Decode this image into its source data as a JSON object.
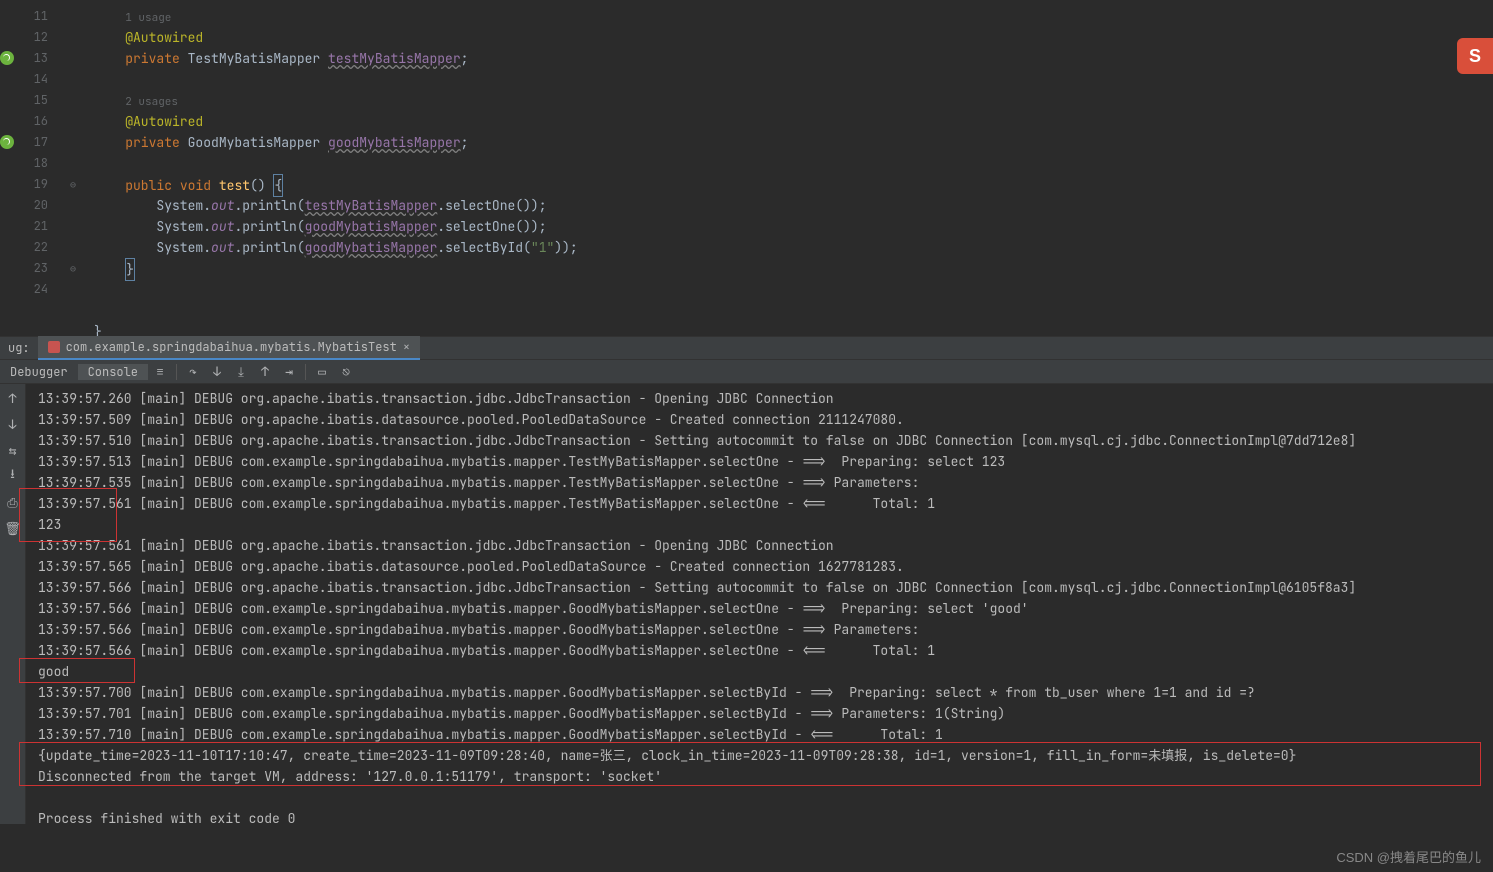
{
  "gutter": {
    "start": 11,
    "end": 24,
    "highlights": [
      12,
      15
    ]
  },
  "editor": {
    "usage1": "1 usage",
    "anno": "@Autowired",
    "kw_private": "private",
    "type1": "TestMyBatisMapper",
    "field1": "testMyBatisMapper",
    "semi": ";",
    "usage2": "2 usages",
    "type2": "GoodMybatisMapper",
    "field2": "goodMybatisMapper",
    "kw_public": "public",
    "kw_void": "void",
    "method_test": "test",
    "paren_empty": "() ",
    "brace_open": "{",
    "brace_close": "}",
    "sys": "System",
    "out": "out",
    "println": "println",
    "call1": "testMyBatisMapper",
    "selectOne": "selectOne",
    "call2": "goodMybatisMapper",
    "selectById": "selectById",
    "arg_str": "\"1\""
  },
  "debugbar": {
    "label": "ug:",
    "tab": "com.example.springdabaihua.mybatis.MybatisTest",
    "close": "×"
  },
  "toolbar2": {
    "debugger": "Debugger",
    "console": "Console"
  },
  "console_lines": [
    "13:39:57.260 [main] DEBUG org.apache.ibatis.transaction.jdbc.JdbcTransaction - Opening JDBC Connection",
    "13:39:57.509 [main] DEBUG org.apache.ibatis.datasource.pooled.PooledDataSource - Created connection 2111247080.",
    "13:39:57.510 [main] DEBUG org.apache.ibatis.transaction.jdbc.JdbcTransaction - Setting autocommit to false on JDBC Connection [com.mysql.cj.jdbc.ConnectionImpl@7dd712e8]",
    "13:39:57.513 [main] DEBUG com.example.springdabaihua.mybatis.mapper.TestMyBatisMapper.selectOne - ==>  Preparing: select 123",
    "13:39:57.535 [main] DEBUG com.example.springdabaihua.mybatis.mapper.TestMyBatisMapper.selectOne - ==> Parameters: ",
    "13:39:57.561 [main] DEBUG com.example.springdabaihua.mybatis.mapper.TestMyBatisMapper.selectOne - <==      Total: 1",
    "123",
    "13:39:57.561 [main] DEBUG org.apache.ibatis.transaction.jdbc.JdbcTransaction - Opening JDBC Connection",
    "13:39:57.565 [main] DEBUG org.apache.ibatis.datasource.pooled.PooledDataSource - Created connection 1627781283.",
    "13:39:57.566 [main] DEBUG org.apache.ibatis.transaction.jdbc.JdbcTransaction - Setting autocommit to false on JDBC Connection [com.mysql.cj.jdbc.ConnectionImpl@6105f8a3]",
    "13:39:57.566 [main] DEBUG com.example.springdabaihua.mybatis.mapper.GoodMybatisMapper.selectOne - ==>  Preparing: select 'good'",
    "13:39:57.566 [main] DEBUG com.example.springdabaihua.mybatis.mapper.GoodMybatisMapper.selectOne - ==> Parameters: ",
    "13:39:57.566 [main] DEBUG com.example.springdabaihua.mybatis.mapper.GoodMybatisMapper.selectOne - <==      Total: 1",
    "good",
    "13:39:57.700 [main] DEBUG com.example.springdabaihua.mybatis.mapper.GoodMybatisMapper.selectById - ==>  Preparing: select * from tb_user where 1=1 and id =?",
    "13:39:57.701 [main] DEBUG com.example.springdabaihua.mybatis.mapper.GoodMybatisMapper.selectById - ==> Parameters: 1(String)",
    "13:39:57.710 [main] DEBUG com.example.springdabaihua.mybatis.mapper.GoodMybatisMapper.selectById - <==      Total: 1",
    "{update_time=2023-11-10T17:10:47, create_time=2023-11-09T09:28:40, name=张三, clock_in_time=2023-11-09T09:28:38, id=1, version=1, fill_in_form=未填报, is_delete=0}",
    "Disconnected from the target VM, address: '127.0.0.1:51179', transport: 'socket'",
    "",
    "Process finished with exit code 0"
  ],
  "watermark": "CSDN @拽着尾巴的鱼儿",
  "badge": "S"
}
